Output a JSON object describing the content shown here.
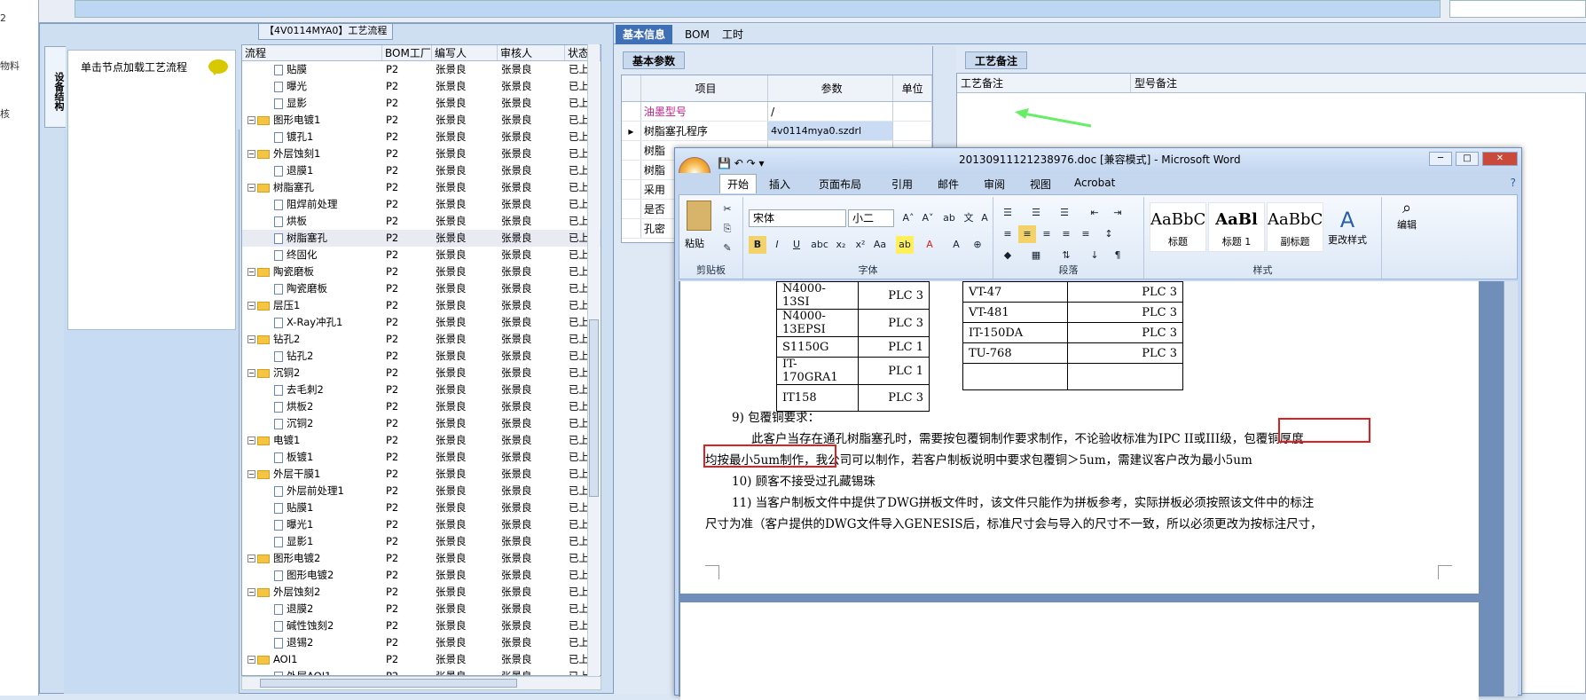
{
  "left_strip": {
    "items": [
      "2",
      "物料",
      "核"
    ]
  },
  "left_panel": {
    "title": "【4V0114MYA0】工艺流程",
    "vertical_tab": "设备结构",
    "hint": "单击节点加载工艺流程"
  },
  "tree": {
    "headers": [
      "流程",
      "BOM工厂",
      "编写人",
      "审核人",
      "状态"
    ],
    "rows": [
      {
        "lvl": 2,
        "name": "贴膜",
        "bom": "P2",
        "w": "张景良",
        "r": "张景良",
        "s": "已上网"
      },
      {
        "lvl": 2,
        "name": "曝光",
        "bom": "P2",
        "w": "张景良",
        "r": "张景良",
        "s": "已上网"
      },
      {
        "lvl": 2,
        "name": "显影",
        "bom": "P2",
        "w": "张景良",
        "r": "张景良",
        "s": "已上网"
      },
      {
        "lvl": 1,
        "name": "图形电镀1",
        "bom": "P2",
        "w": "张景良",
        "r": "张景良",
        "s": "已上网"
      },
      {
        "lvl": 2,
        "name": "镀孔1",
        "bom": "P2",
        "w": "张景良",
        "r": "张景良",
        "s": "已上网"
      },
      {
        "lvl": 1,
        "name": "外层蚀刻1",
        "bom": "P2",
        "w": "张景良",
        "r": "张景良",
        "s": "已上网"
      },
      {
        "lvl": 2,
        "name": "退膜1",
        "bom": "P2",
        "w": "张景良",
        "r": "张景良",
        "s": "已上网"
      },
      {
        "lvl": 1,
        "name": "树脂塞孔",
        "bom": "P2",
        "w": "张景良",
        "r": "张景良",
        "s": "已上网"
      },
      {
        "lvl": 2,
        "name": "阻焊前处理",
        "bom": "P2",
        "w": "张景良",
        "r": "张景良",
        "s": "已上网"
      },
      {
        "lvl": 2,
        "name": "烘板",
        "bom": "P2",
        "w": "张景良",
        "r": "张景良",
        "s": "已上网"
      },
      {
        "lvl": 2,
        "name": "树脂塞孔",
        "bom": "P2",
        "w": "张景良",
        "r": "张景良",
        "s": "已上网"
      },
      {
        "lvl": 2,
        "name": "终固化",
        "bom": "P2",
        "w": "张景良",
        "r": "张景良",
        "s": "已上网"
      },
      {
        "lvl": 1,
        "name": "陶瓷磨板",
        "bom": "P2",
        "w": "张景良",
        "r": "张景良",
        "s": "已上网"
      },
      {
        "lvl": 2,
        "name": "陶瓷磨板",
        "bom": "P2",
        "w": "张景良",
        "r": "张景良",
        "s": "已上网"
      },
      {
        "lvl": 1,
        "name": "层压1",
        "bom": "P2",
        "w": "张景良",
        "r": "张景良",
        "s": "已上网"
      },
      {
        "lvl": 2,
        "name": "X-Ray冲孔1",
        "bom": "P2",
        "w": "张景良",
        "r": "张景良",
        "s": "已上网"
      },
      {
        "lvl": 1,
        "name": "钻孔2",
        "bom": "P2",
        "w": "张景良",
        "r": "张景良",
        "s": "已上网"
      },
      {
        "lvl": 2,
        "name": "钻孔2",
        "bom": "P2",
        "w": "张景良",
        "r": "张景良",
        "s": "已上网"
      },
      {
        "lvl": 1,
        "name": "沉铜2",
        "bom": "P2",
        "w": "张景良",
        "r": "张景良",
        "s": "已上网"
      },
      {
        "lvl": 2,
        "name": "去毛刺2",
        "bom": "P2",
        "w": "张景良",
        "r": "张景良",
        "s": "已上网"
      },
      {
        "lvl": 2,
        "name": "烘板2",
        "bom": "P2",
        "w": "张景良",
        "r": "张景良",
        "s": "已上网"
      },
      {
        "lvl": 2,
        "name": "沉铜2",
        "bom": "P2",
        "w": "张景良",
        "r": "张景良",
        "s": "已上网"
      },
      {
        "lvl": 1,
        "name": "电镀1",
        "bom": "P2",
        "w": "张景良",
        "r": "张景良",
        "s": "已上网"
      },
      {
        "lvl": 2,
        "name": "板镀1",
        "bom": "P2",
        "w": "张景良",
        "r": "张景良",
        "s": "已上网"
      },
      {
        "lvl": 1,
        "name": "外层干膜1",
        "bom": "P2",
        "w": "张景良",
        "r": "张景良",
        "s": "已上网"
      },
      {
        "lvl": 2,
        "name": "外层前处理1",
        "bom": "P2",
        "w": "张景良",
        "r": "张景良",
        "s": "已上网"
      },
      {
        "lvl": 2,
        "name": "贴膜1",
        "bom": "P2",
        "w": "张景良",
        "r": "张景良",
        "s": "已上网"
      },
      {
        "lvl": 2,
        "name": "曝光1",
        "bom": "P2",
        "w": "张景良",
        "r": "张景良",
        "s": "已上网"
      },
      {
        "lvl": 2,
        "name": "显影1",
        "bom": "P2",
        "w": "张景良",
        "r": "张景良",
        "s": "已上网"
      },
      {
        "lvl": 1,
        "name": "图形电镀2",
        "bom": "P2",
        "w": "张景良",
        "r": "张景良",
        "s": "已上网"
      },
      {
        "lvl": 2,
        "name": "图形电镀2",
        "bom": "P2",
        "w": "张景良",
        "r": "张景良",
        "s": "已上网"
      },
      {
        "lvl": 1,
        "name": "外层蚀刻2",
        "bom": "P2",
        "w": "张景良",
        "r": "张景良",
        "s": "已上网"
      },
      {
        "lvl": 2,
        "name": "退膜2",
        "bom": "P2",
        "w": "张景良",
        "r": "张景良",
        "s": "已上网"
      },
      {
        "lvl": 2,
        "name": "碱性蚀刻2",
        "bom": "P2",
        "w": "张景良",
        "r": "张景良",
        "s": "已上网"
      },
      {
        "lvl": 2,
        "name": "退锡2",
        "bom": "P2",
        "w": "张景良",
        "r": "张景良",
        "s": "已上网"
      },
      {
        "lvl": 1,
        "name": "AOI1",
        "bom": "P2",
        "w": "张景良",
        "r": "张景良",
        "s": "已上网"
      },
      {
        "lvl": 2,
        "name": "外层AOI1",
        "bom": "P2",
        "w": "张景良",
        "r": "张景良",
        "s": "已上网"
      }
    ]
  },
  "right_tabs": [
    "基本信息",
    "BOM",
    "工时"
  ],
  "basic": {
    "panel_tab": "基本参数",
    "headers": [
      "项目",
      "参数",
      "单位"
    ],
    "rows": [
      {
        "item": "油墨型号",
        "param": "/",
        "unit": ""
      },
      {
        "item": "树脂塞孔程序",
        "param": "4v0114mya0.szdrl",
        "unit": ""
      },
      {
        "item": "树脂",
        "param": "",
        "unit": ""
      },
      {
        "item": "树脂",
        "param": "",
        "unit": ""
      },
      {
        "item": "采用",
        "param": "",
        "unit": ""
      },
      {
        "item": "是否",
        "param": "",
        "unit": ""
      },
      {
        "item": "孔密",
        "param": "",
        "unit": ""
      }
    ]
  },
  "notes": {
    "panel_tab": "工艺备注",
    "col1": "工艺备注",
    "col2": "型号备注",
    "arrow_color": "#66ee66"
  },
  "word": {
    "title": "20130911121238976.doc [兼容模式] - Microsoft Word",
    "ribbon_tabs": [
      "开始",
      "插入",
      "页面布局",
      "引用",
      "邮件",
      "审阅",
      "视图",
      "Acrobat"
    ],
    "font_name": "宋体",
    "font_size": "小二",
    "group_labels": [
      "剪贴板",
      "字体",
      "段落",
      "样式"
    ],
    "paste_label": "粘贴",
    "change_styles": "更改样式",
    "edit": "编辑",
    "styles": [
      {
        "preview": "AaBbC",
        "name": "标题"
      },
      {
        "preview": "AaBl",
        "name": "标题 1"
      },
      {
        "preview": "AaBbC",
        "name": "副标题"
      }
    ],
    "table": [
      [
        "N4000-13SI",
        "PLC 3",
        "VT-47",
        "PLC 3"
      ],
      [
        "N4000-13EPSI",
        "PLC 3",
        "VT-481",
        "PLC 3"
      ],
      [
        "S1150G",
        "PLC 1",
        "IT-150DA",
        "PLC 3"
      ],
      [
        "IT-170GRA1",
        "PLC 1",
        "TU-768",
        "PLC 3"
      ],
      [
        "IT158",
        "PLC 3",
        "",
        ""
      ]
    ],
    "p1": "9) 包覆铜要求：",
    "p2": "此客户当存在通孔树脂塞孔时，需要按包覆铜制作要求制作，不论验收标准为IPC II或III级，包覆铜厚度",
    "p3": "均按最小5um制作，我公司可以制作，若客户制板说明中要求包覆铜＞5um，需建议客户改为最小5um",
    "p4": "10) 顾客不接受过孔藏锡珠",
    "p5": "11) 当客户制板文件中提供了DWG拼板文件时，该文件只能作为拼板参考，实际拼板必须按照该文件中的标注",
    "p6": "尺寸为准（客户提供的DWG文件导入GENESIS后，标准尺寸会与导入的尺寸不一致，所以必须更改为按标注尺寸，"
  }
}
